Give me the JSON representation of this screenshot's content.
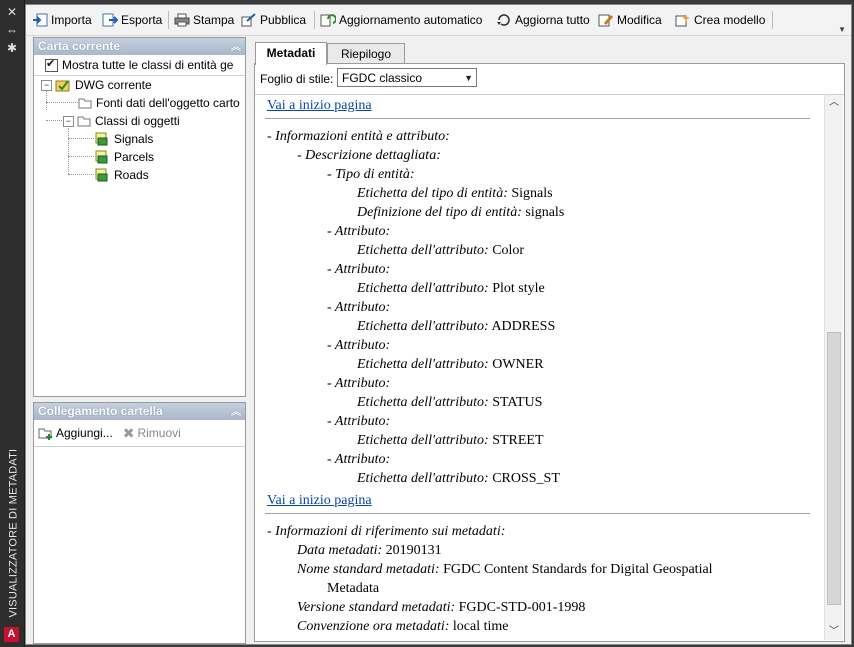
{
  "palette": {
    "panel_header": "#b6c3d6",
    "link": "#0645ad",
    "sidebar": "#2d2d2d",
    "brand_red": "#c8102e"
  },
  "window": {
    "vertical_title": "VISUALIZZATORE DI METADATI",
    "logo_letter": "A"
  },
  "toolbar": {
    "importa": "Importa",
    "esporta": "Esporta",
    "stampa": "Stampa",
    "pubblica": "Pubblica",
    "aggiornamento_automatico": "Aggiornamento automatico",
    "aggiorna_tutto": "Aggiorna tutto",
    "modifica": "Modifica",
    "crea_modello": "Crea modello"
  },
  "carta_corrente": {
    "title": "Carta corrente",
    "show_all_label": "Mostra tutte le classi di entità ge",
    "show_all_checked": true,
    "tree": {
      "root": "DWG corrente",
      "fonti": "Fonti dati dell'oggetto carto",
      "classi": "Classi di oggetti",
      "items": [
        "Signals",
        "Parcels",
        "Roads"
      ]
    }
  },
  "collegamento": {
    "title": "Collegamento cartella",
    "add_label": "Aggiungi...",
    "remove_label": "Rimuovi"
  },
  "tabs": {
    "metadati": "Metadati",
    "riepilogo": "Riepilogo"
  },
  "style": {
    "label": "Foglio di stile:",
    "value": "FGDC classico"
  },
  "document": {
    "top_link": "Vai a inizio pagina",
    "section1": {
      "title": "- Informazioni entità e attributo:",
      "detail": "- Descrizione dettagliata:",
      "entity_type": "- Tipo di entità:",
      "entity_label_key": "Etichetta del tipo di entità:",
      "entity_label_val": "Signals",
      "entity_def_key": "Definizione del tipo di entità:",
      "entity_def_val": "signals",
      "attribute_heading": "- Attributo:",
      "attribute_key": "Etichetta dell'attributo:",
      "attributes": [
        "Color",
        "Plot style",
        "ADDRESS",
        "OWNER",
        "STATUS",
        "STREET",
        "CROSS_ST"
      ]
    },
    "section2": {
      "title": "- Informazioni di riferimento sui metadati:",
      "date_key": "Data metadati:",
      "date_val": "20190131",
      "std_name_key": "Nome standard metadati:",
      "std_name_val": "FGDC Content Standards for Digital Geospatial",
      "std_name_val2": "Metadata",
      "std_ver_key": "Versione standard metadati:",
      "std_ver_val": "FGDC-STD-001-1998",
      "time_key": "Convenzione ora metadati:",
      "time_val": "local time"
    }
  }
}
